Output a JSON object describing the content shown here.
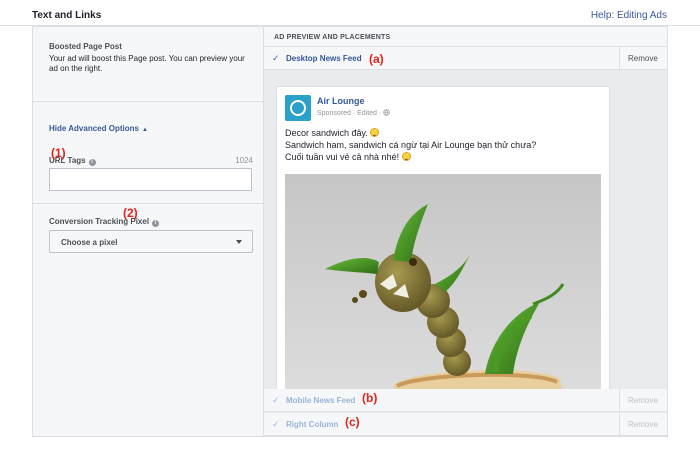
{
  "header": {
    "title": "Text and Links",
    "help_link": "Help: Editing Ads"
  },
  "left": {
    "boost_title": "Boosted Page Post",
    "boost_desc": "Your ad will boost this Page post. You can preview your ad on the right.",
    "hide_advanced": "Hide Advanced Options",
    "hide_advanced_arrow": "▲",
    "url_tags_label": "URL Tags",
    "url_tags_count": "1024",
    "url_tags_value": "",
    "info_glyph": "i",
    "conversion_label": "Conversion Tracking Pixel",
    "pixel_select_value": "Choose a pixel"
  },
  "preview": {
    "header": "AD PREVIEW AND PLACEMENTS",
    "check_glyph": "✓",
    "placements": [
      {
        "name": "Desktop News Feed",
        "remove": "Remove",
        "selected": true
      },
      {
        "name": "Mobile News Feed",
        "remove": "Remove",
        "selected": false
      },
      {
        "name": "Right Column",
        "remove": "Remove",
        "selected": false
      }
    ],
    "post": {
      "page_name": "Air Lounge",
      "meta": "Sponsored · Edited ·",
      "line1": "Decor sandwich đây.",
      "line2": "Sandwich ham, sandwich cá ngừ tại Air Lounge bạn thử chưa?",
      "line3": "Cuối tuần vui vẻ cả nhà nhé!"
    }
  },
  "callouts": {
    "a": "(a)",
    "b": "(b)",
    "c": "(c)",
    "one": "(1)",
    "two": "(2)"
  },
  "colors": {
    "link": "#365899",
    "callout": "#e0241b",
    "panel_bg": "#f6f7f9"
  }
}
